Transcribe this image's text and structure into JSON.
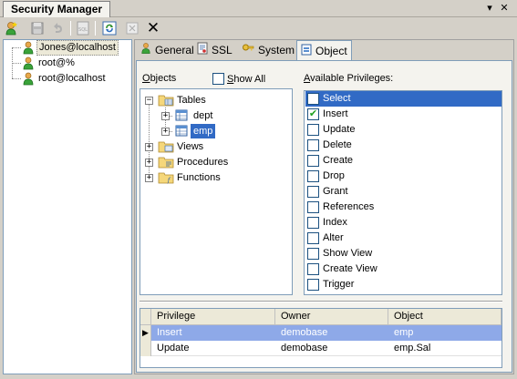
{
  "window": {
    "title": "Security Manager",
    "pin_glyph": "▾",
    "close_glyph": "✕"
  },
  "toolbar": {
    "buttons": [
      {
        "name": "add-user-icon"
      },
      {
        "name": "save-icon"
      },
      {
        "name": "undo-icon"
      },
      {
        "name": "sql-icon"
      },
      {
        "name": "refresh-icon"
      },
      {
        "name": "disabled-icon"
      },
      {
        "name": "delete-icon",
        "glyph": "✕"
      }
    ]
  },
  "users": [
    {
      "label": "Jones@localhost",
      "selected": true
    },
    {
      "label": "root@%",
      "selected": false
    },
    {
      "label": "root@localhost",
      "selected": false
    }
  ],
  "tabs": [
    {
      "label": "General",
      "active": false
    },
    {
      "label": "SSL",
      "active": false
    },
    {
      "label": "System",
      "active": false
    },
    {
      "label": "Object",
      "active": true
    }
  ],
  "objects_panel": {
    "label_prefix": "O",
    "label_rest": "bjects",
    "show_all_prefix": "S",
    "show_all_rest": "how All",
    "show_all_checked": false,
    "tree": [
      {
        "label": "Tables",
        "expander": "−"
      },
      {
        "label": "dept",
        "expander": "+"
      },
      {
        "label": "emp",
        "expander": "+",
        "selected": true
      },
      {
        "label": "Views",
        "expander": "+"
      },
      {
        "label": "Procedures",
        "expander": "+"
      },
      {
        "label": "Functions",
        "expander": "+"
      }
    ]
  },
  "privileges_panel": {
    "label_prefix": "A",
    "label_rest": "vailable Privileges:",
    "items": [
      {
        "label": "Select",
        "checked": false,
        "selected": true
      },
      {
        "label": "Insert",
        "checked": true,
        "selected": false
      },
      {
        "label": "Update",
        "checked": false,
        "selected": false
      },
      {
        "label": "Delete",
        "checked": false,
        "selected": false
      },
      {
        "label": "Create",
        "checked": false,
        "selected": false
      },
      {
        "label": "Drop",
        "checked": false,
        "selected": false
      },
      {
        "label": "Grant",
        "checked": false,
        "selected": false
      },
      {
        "label": "References",
        "checked": false,
        "selected": false
      },
      {
        "label": "Index",
        "checked": false,
        "selected": false
      },
      {
        "label": "Alter",
        "checked": false,
        "selected": false
      },
      {
        "label": "Show View",
        "checked": false,
        "selected": false
      },
      {
        "label": "Create View",
        "checked": false,
        "selected": false
      },
      {
        "label": "Trigger",
        "checked": false,
        "selected": false
      }
    ],
    "check_glyph": "✔"
  },
  "grid": {
    "columns": [
      "Privilege",
      "Owner",
      "Object"
    ],
    "rows": [
      {
        "privilege": "Insert",
        "owner": "demobase",
        "object": "emp",
        "selected": true,
        "indicator": "▶"
      },
      {
        "privilege": "Update",
        "owner": "demobase",
        "object": "emp.Sal",
        "selected": false,
        "indicator": ""
      }
    ]
  },
  "colors": {
    "selection": "#316ac5",
    "grid_selection": "#8ea9e8",
    "border": "#7f9db9",
    "panel": "#d4d0c8"
  }
}
